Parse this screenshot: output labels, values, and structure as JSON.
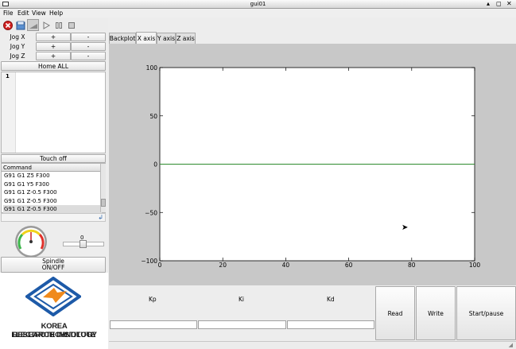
{
  "window": {
    "title": "gui01",
    "controls": [
      "▴",
      "◻",
      "✕"
    ]
  },
  "menu": [
    "File",
    "Edit",
    "View",
    "Help"
  ],
  "toolbar": {
    "icons": [
      "stop-icon",
      "open-icon",
      "reload-icon",
      "play-icon",
      "pause-icon",
      "square-stop-icon"
    ],
    "colors": {
      "stop": "#d32020"
    }
  },
  "jog": [
    {
      "label": "Jog X",
      "plus": "+",
      "minus": "-"
    },
    {
      "label": "Jog Y",
      "plus": "+",
      "minus": "-"
    },
    {
      "label": "Jog Z",
      "plus": "+",
      "minus": "-"
    }
  ],
  "home_all": "Home ALL",
  "editor": {
    "line_number": "1"
  },
  "touch_off": "Touch off",
  "command_list": {
    "header": "Command",
    "rows": [
      "G91 G1 Z5 F300",
      "G91 G1 Y5 F300",
      "G91 G1 Z-0.5 F300",
      "G91 G1 Z-0.5 F300",
      "G91 G1 Z-0.5 F300"
    ]
  },
  "spindle": {
    "slider_value": "0",
    "button_line1": "Spindle",
    "button_line2": "ON/OFF"
  },
  "logo": {
    "line1": "KOREA ELECTROTECHNOLOGY",
    "line2": "RESEARCH INSTITUTE",
    "colors": {
      "orange": "#f08a1c",
      "blue": "#1d5aa8"
    }
  },
  "tabs": [
    "Backplot",
    "X axis",
    "Y axis",
    "Z axis"
  ],
  "active_tab": "X axis",
  "chart_data": {
    "type": "line",
    "series": [
      {
        "x": [
          0,
          100
        ],
        "y": [
          0,
          0
        ],
        "color": "#2e8b2e"
      }
    ],
    "xlim": [
      0,
      100
    ],
    "ylim": [
      -100,
      100
    ],
    "x_ticks": [
      "0",
      "20",
      "40",
      "60",
      "80",
      "100"
    ],
    "y_ticks": [
      "100",
      "50",
      "0",
      "−50",
      "−100"
    ],
    "grid": false
  },
  "pid": {
    "labels": [
      "Kp",
      "Ki",
      "Kd"
    ],
    "values": [
      "",
      "",
      ""
    ]
  },
  "actions": {
    "read": "Read",
    "write": "Write",
    "start_pause": "Start/pause"
  }
}
